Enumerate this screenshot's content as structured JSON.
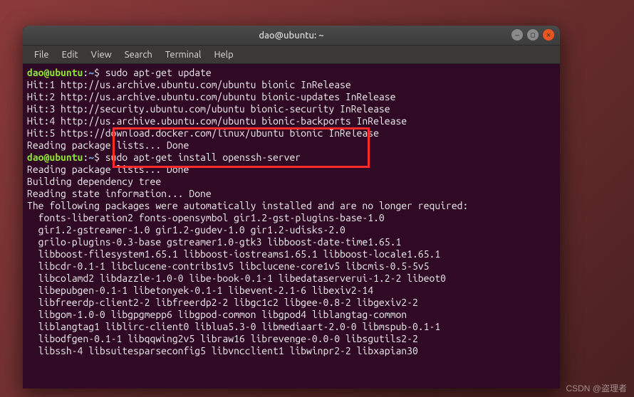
{
  "window": {
    "title": "dao@ubuntu: ~"
  },
  "menubar": {
    "items": [
      "File",
      "Edit",
      "View",
      "Search",
      "Terminal",
      "Help"
    ]
  },
  "prompt": {
    "user_host": "dao@ubuntu",
    "sep": ":",
    "path": "~",
    "marker": "$ "
  },
  "terminal": {
    "cmd1": "sudo apt-get update",
    "lines1": [
      "Hit:1 http://us.archive.ubuntu.com/ubuntu bionic InRelease",
      "Hit:2 http://us.archive.ubuntu.com/ubuntu bionic-updates InRelease",
      "Hit:3 http://security.ubuntu.com/ubuntu bionic-security InRelease",
      "Hit:4 http://us.archive.ubuntu.com/ubuntu bionic-backports InRelease",
      "Hit:5 https://download.docker.com/linux/ubuntu bionic InRelease",
      "Reading package lists... Done"
    ],
    "cmd2": "sudo apt-get install openssh-server",
    "lines2": [
      "Reading package lists... Done",
      "Building dependency tree       ",
      "Reading state information... Done",
      "The following packages were automatically installed and are no longer required:",
      "  fonts-liberation2 fonts-opensymbol gir1.2-gst-plugins-base-1.0",
      "  gir1.2-gstreamer-1.0 gir1.2-gudev-1.0 gir1.2-udisks-2.0",
      "  grilo-plugins-0.3-base gstreamer1.0-gtk3 libboost-date-time1.65.1",
      "  libboost-filesystem1.65.1 libboost-iostreams1.65.1 libboost-locale1.65.1",
      "  libcdr-0.1-1 libclucene-contribs1v5 libclucene-core1v5 libcmis-0.5-5v5",
      "  libcolamd2 libdazzle-1.0-0 libe-book-0.1-1 libedataserverui-1.2-2 libeot0",
      "  libepubgen-0.1-1 libetonyek-0.1-1 libevent-2.1-6 libexiv2-14",
      "  libfreerdp-client2-2 libfreerdp2-2 libgc1c2 libgee-0.8-2 libgexiv2-2",
      "  libgom-1.0-0 libgpgmepp6 libgpod-common libgpod4 liblangtag-common",
      "  liblangtag1 liblirc-client0 liblua5.3-0 libmediaart-2.0-0 libmspub-0.1-1",
      "  libodfgen-0.1-1 libqqwing2v5 libraw16 librevenge-0.0-0 libsgutils2-2",
      "  libssh-4 libsuitesparseconfig5 libvncclient1 libwinpr2-2 libxapian30"
    ]
  },
  "watermark": "CSDN @盗理者"
}
